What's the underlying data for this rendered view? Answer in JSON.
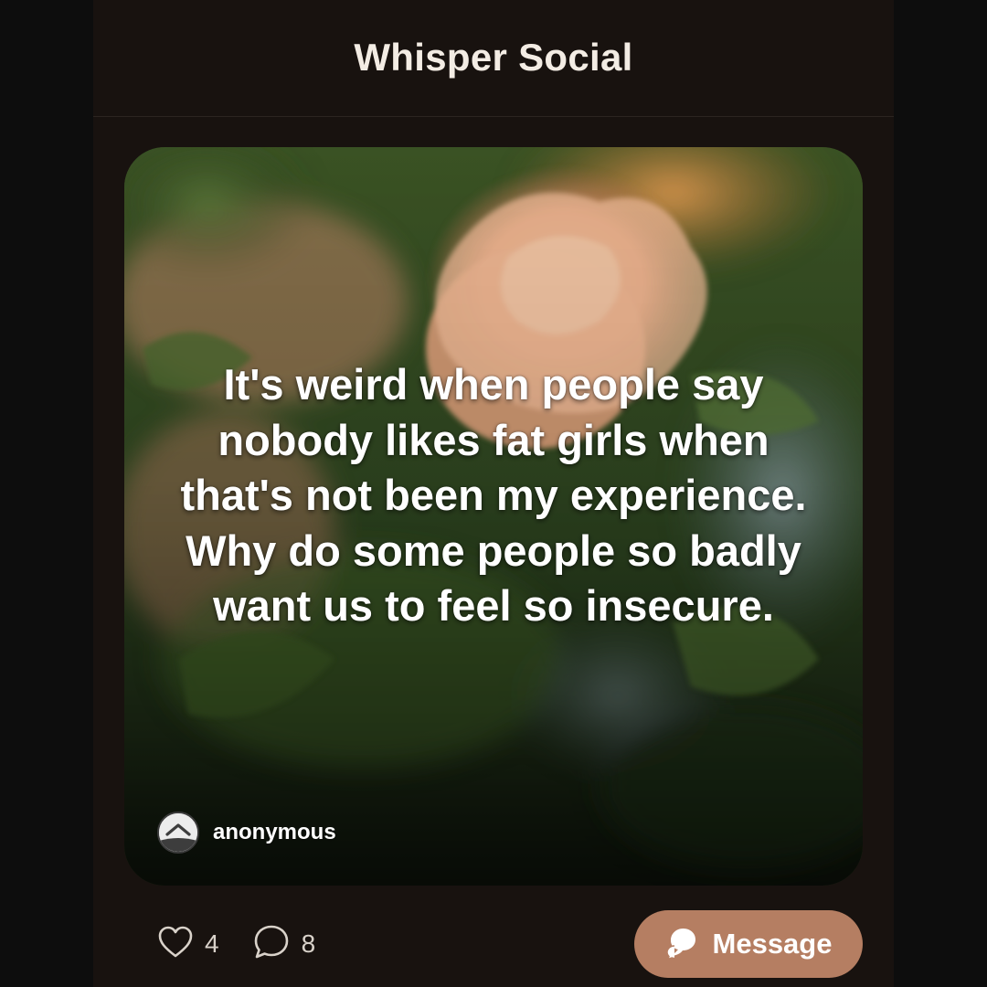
{
  "header": {
    "title": "Whisper Social"
  },
  "post": {
    "text": "It's weird when people say nobody likes fat girls when that's not been my experience. Why do some people so badly want us to feel so insecure.",
    "author": "anonymous",
    "background_icon": "rose-photo"
  },
  "actions": {
    "like_count": "4",
    "comment_count": "8",
    "message_label": "Message"
  },
  "colors": {
    "app_background": "#18120f",
    "title_text": "#f3ece4",
    "message_button": "#b57e62",
    "count_text": "#d9d2ca"
  },
  "icons": {
    "like": "heart-icon",
    "comment": "comment-bubble-icon",
    "message": "chat-bubbles-icon",
    "avatar": "anonymous-avatar-icon"
  }
}
